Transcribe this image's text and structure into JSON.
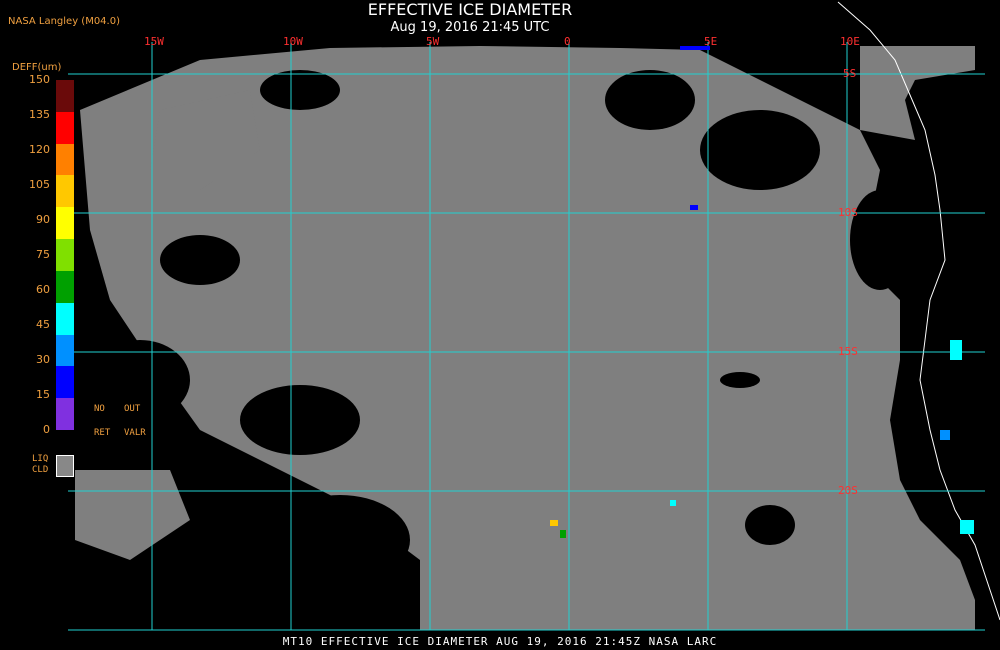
{
  "header": {
    "title": "EFFECTIVE ICE DIAMETER",
    "subtitle": "Aug 19, 2016 21:45 UTC",
    "org": "NASA Langley (M04.0)"
  },
  "grid": {
    "longitudes": [
      "15W",
      "10W",
      "5W",
      "0",
      "5E",
      "10E"
    ],
    "latitudes": [
      "5S",
      "10S",
      "15S",
      "20S"
    ]
  },
  "legend": {
    "unit": "DEFF(um)",
    "ticks": [
      "150",
      "135",
      "120",
      "105",
      "90",
      "75",
      "60",
      "45",
      "30",
      "15",
      "0"
    ],
    "colors": [
      "#6a0a0a",
      "#ff0000",
      "#ff8000",
      "#ffc800",
      "#ffff00",
      "#80e000",
      "#00a000",
      "#00ffff",
      "#0090ff",
      "#0000ff",
      "#8030e0"
    ],
    "no_ret": "NO",
    "ret": "RET",
    "out": "OUT",
    "valr": "VALR",
    "liq": "LIQ",
    "cld": "CLD",
    "liq_color": "#888888"
  },
  "footer": "MT10  EFFECTIVE ICE DIAMETER  AUG 19, 2016 21:45Z  NASA LARC"
}
